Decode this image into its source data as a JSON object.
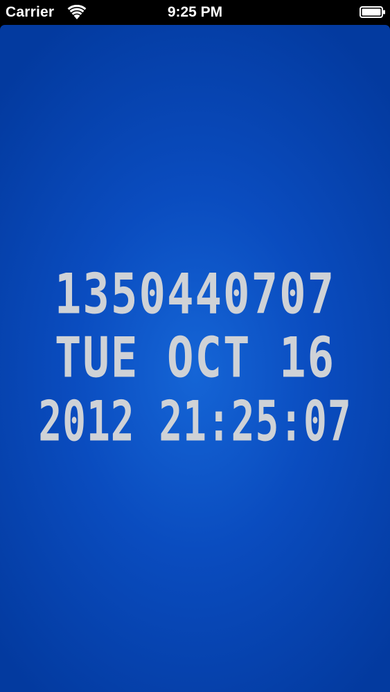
{
  "status_bar": {
    "carrier": "Carrier",
    "time": "9:25 PM",
    "wifi_icon": "wifi-icon",
    "battery_icon": "battery-icon"
  },
  "clock": {
    "epoch": "1350440707",
    "date": "TUE OCT 16",
    "datetime": "2012 21:25:07"
  },
  "colors": {
    "background_center": "#1565d6",
    "background_edge": "#033a9f",
    "text": "#cfd2d6"
  }
}
